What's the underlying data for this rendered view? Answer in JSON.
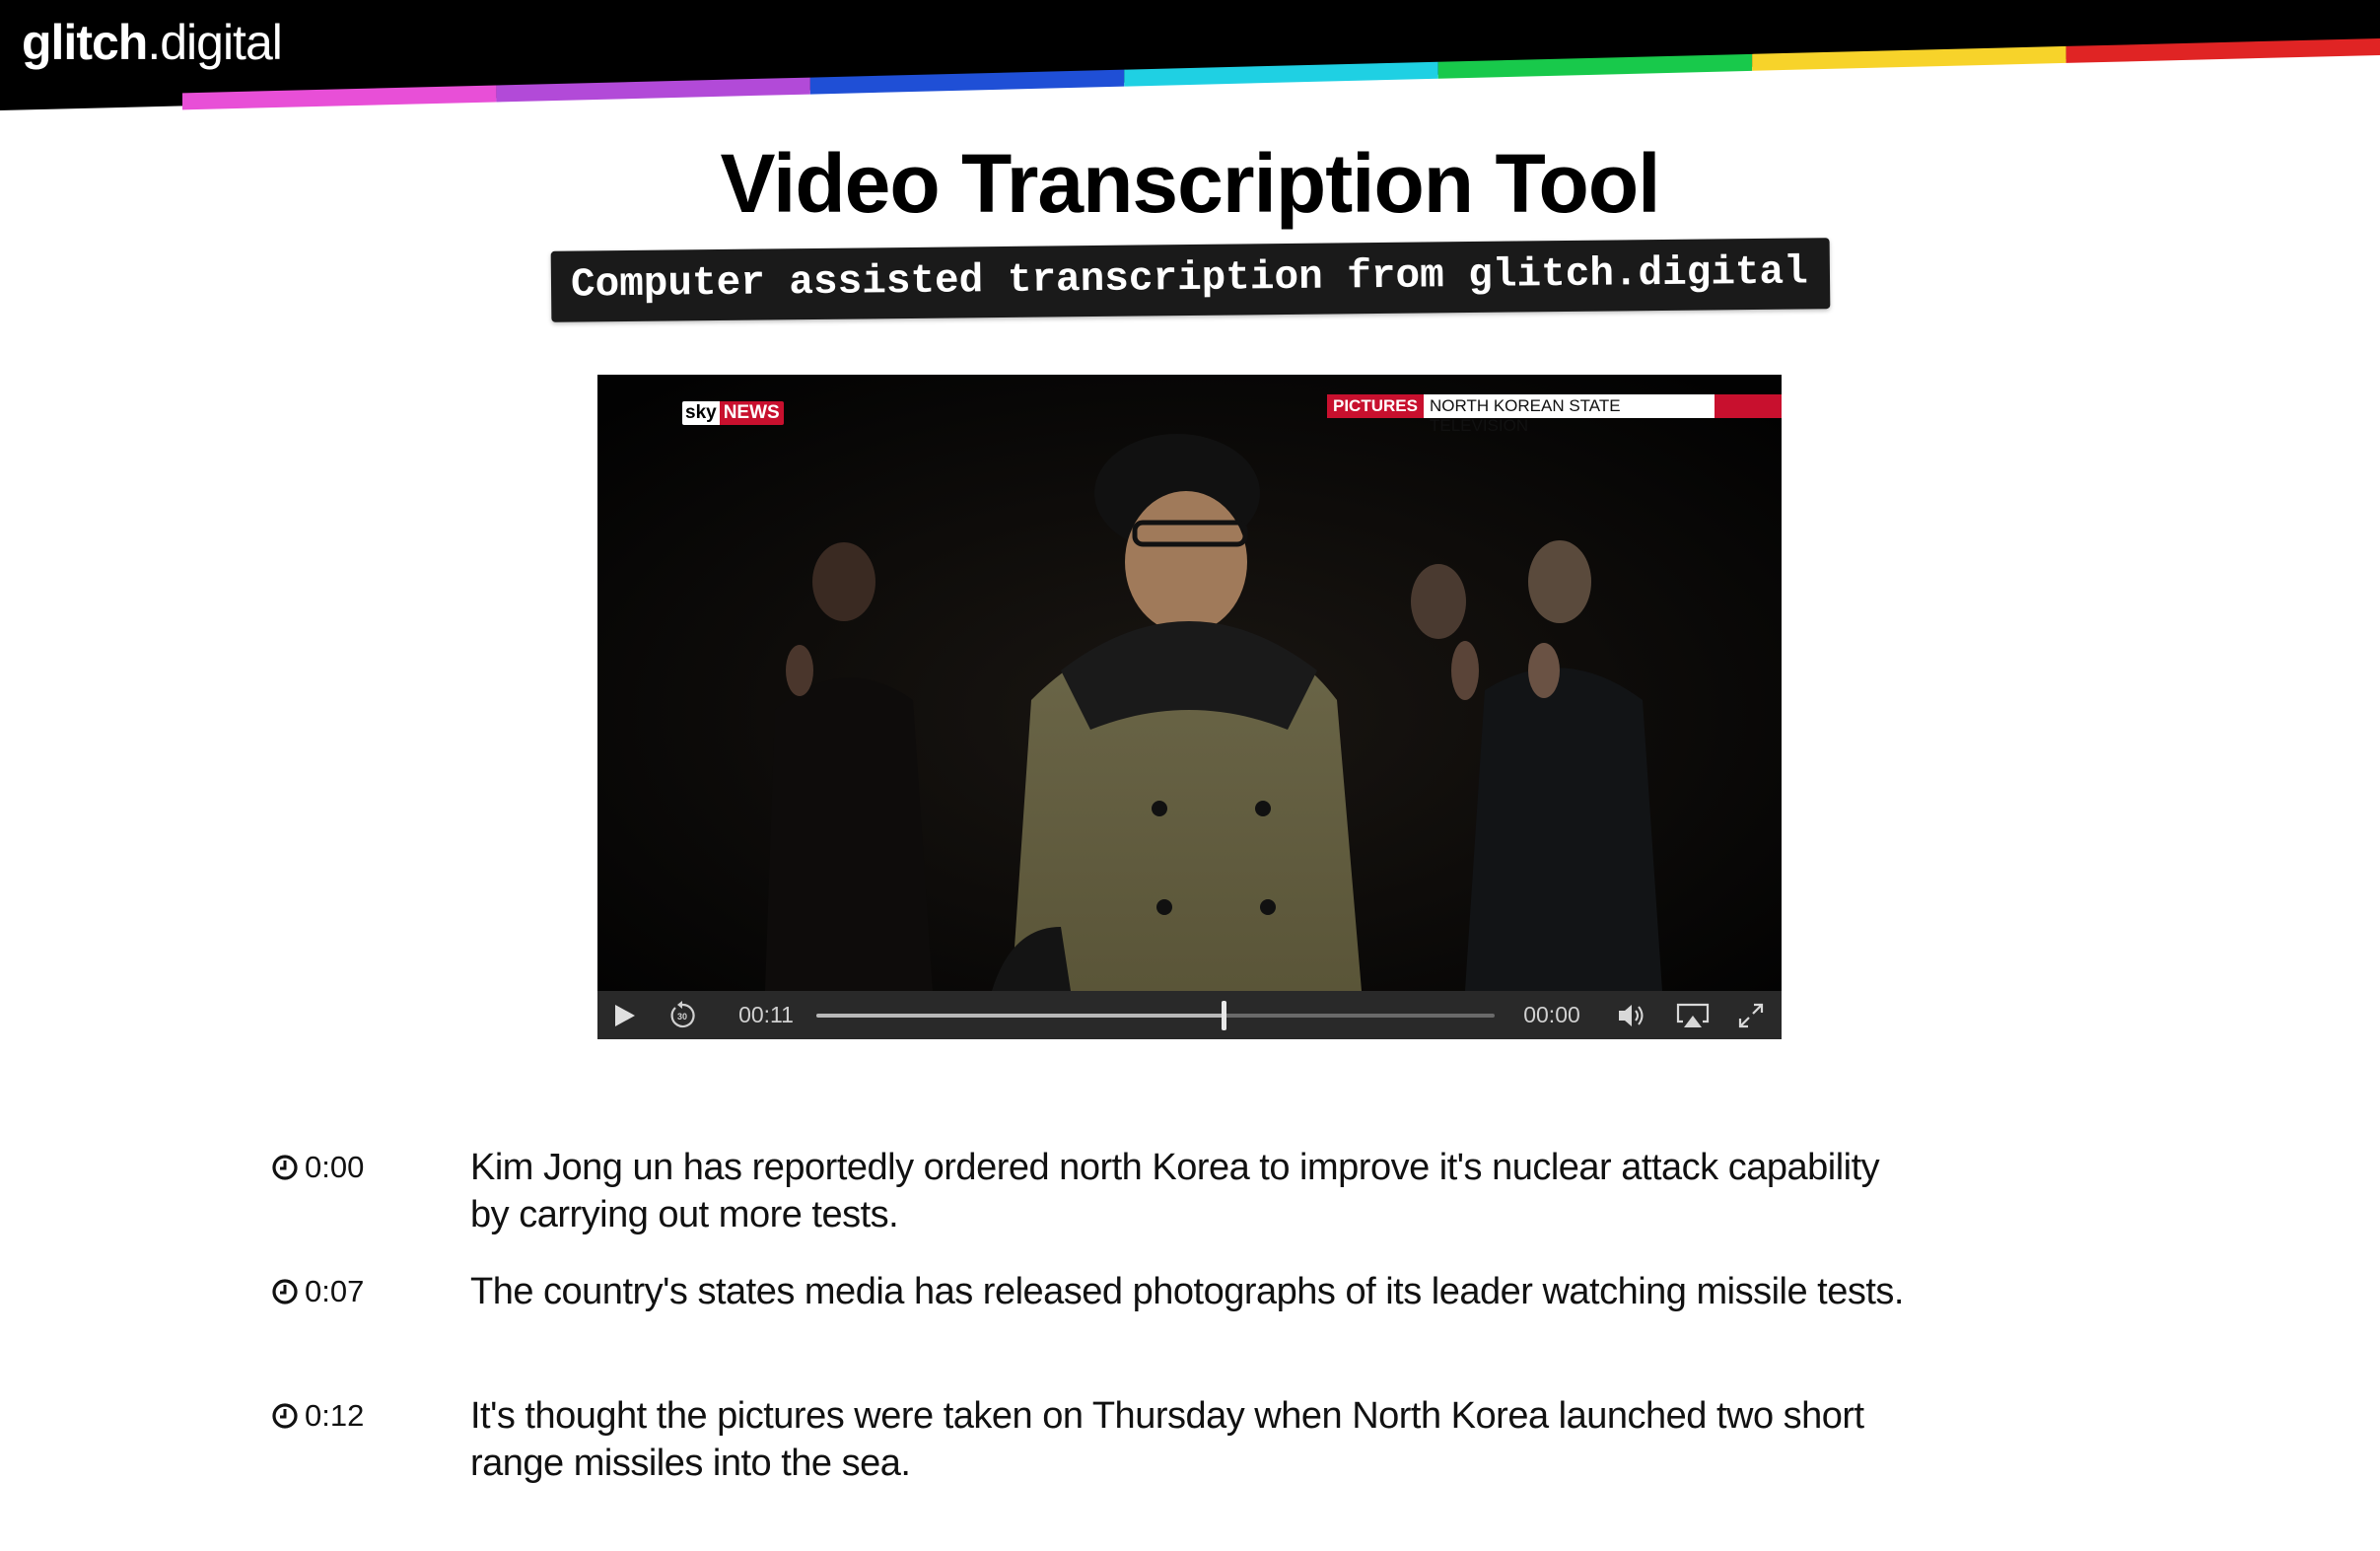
{
  "brand": {
    "logo_bold": "glitch",
    "logo_light": ".digital",
    "stripe_colors": [
      "#e84fd7",
      "#b24ad8",
      "#1f4fd6",
      "#1fd0e3",
      "#18c94b",
      "#f7d32a",
      "#e02424"
    ]
  },
  "page": {
    "title": "Video Transcription Tool",
    "subtitle": "Computer assisted transcription from glitch.digital"
  },
  "video": {
    "channel_logo_sky": "sky",
    "channel_logo_news": "NEWS",
    "caption_label": "PICTURES",
    "caption_source": "NORTH KOREAN STATE TELEVISION",
    "controls": {
      "play_icon": "play-icon",
      "skip_back_label": "30",
      "elapsed": "00:11",
      "remaining": "00:00",
      "progress": 0.6
    }
  },
  "transcript": [
    {
      "time": "0:00",
      "text": "Kim Jong un has reportedly ordered north Korea to improve it's nuclear attack capability by carrying out more tests."
    },
    {
      "time": "0:07",
      "text": "The country's states media has released photographs of its leader watching missile tests."
    },
    {
      "time": "0:12",
      "text": "It's thought the pictures were taken on Thursday when North Korea launched two short range missiles into the sea."
    }
  ]
}
